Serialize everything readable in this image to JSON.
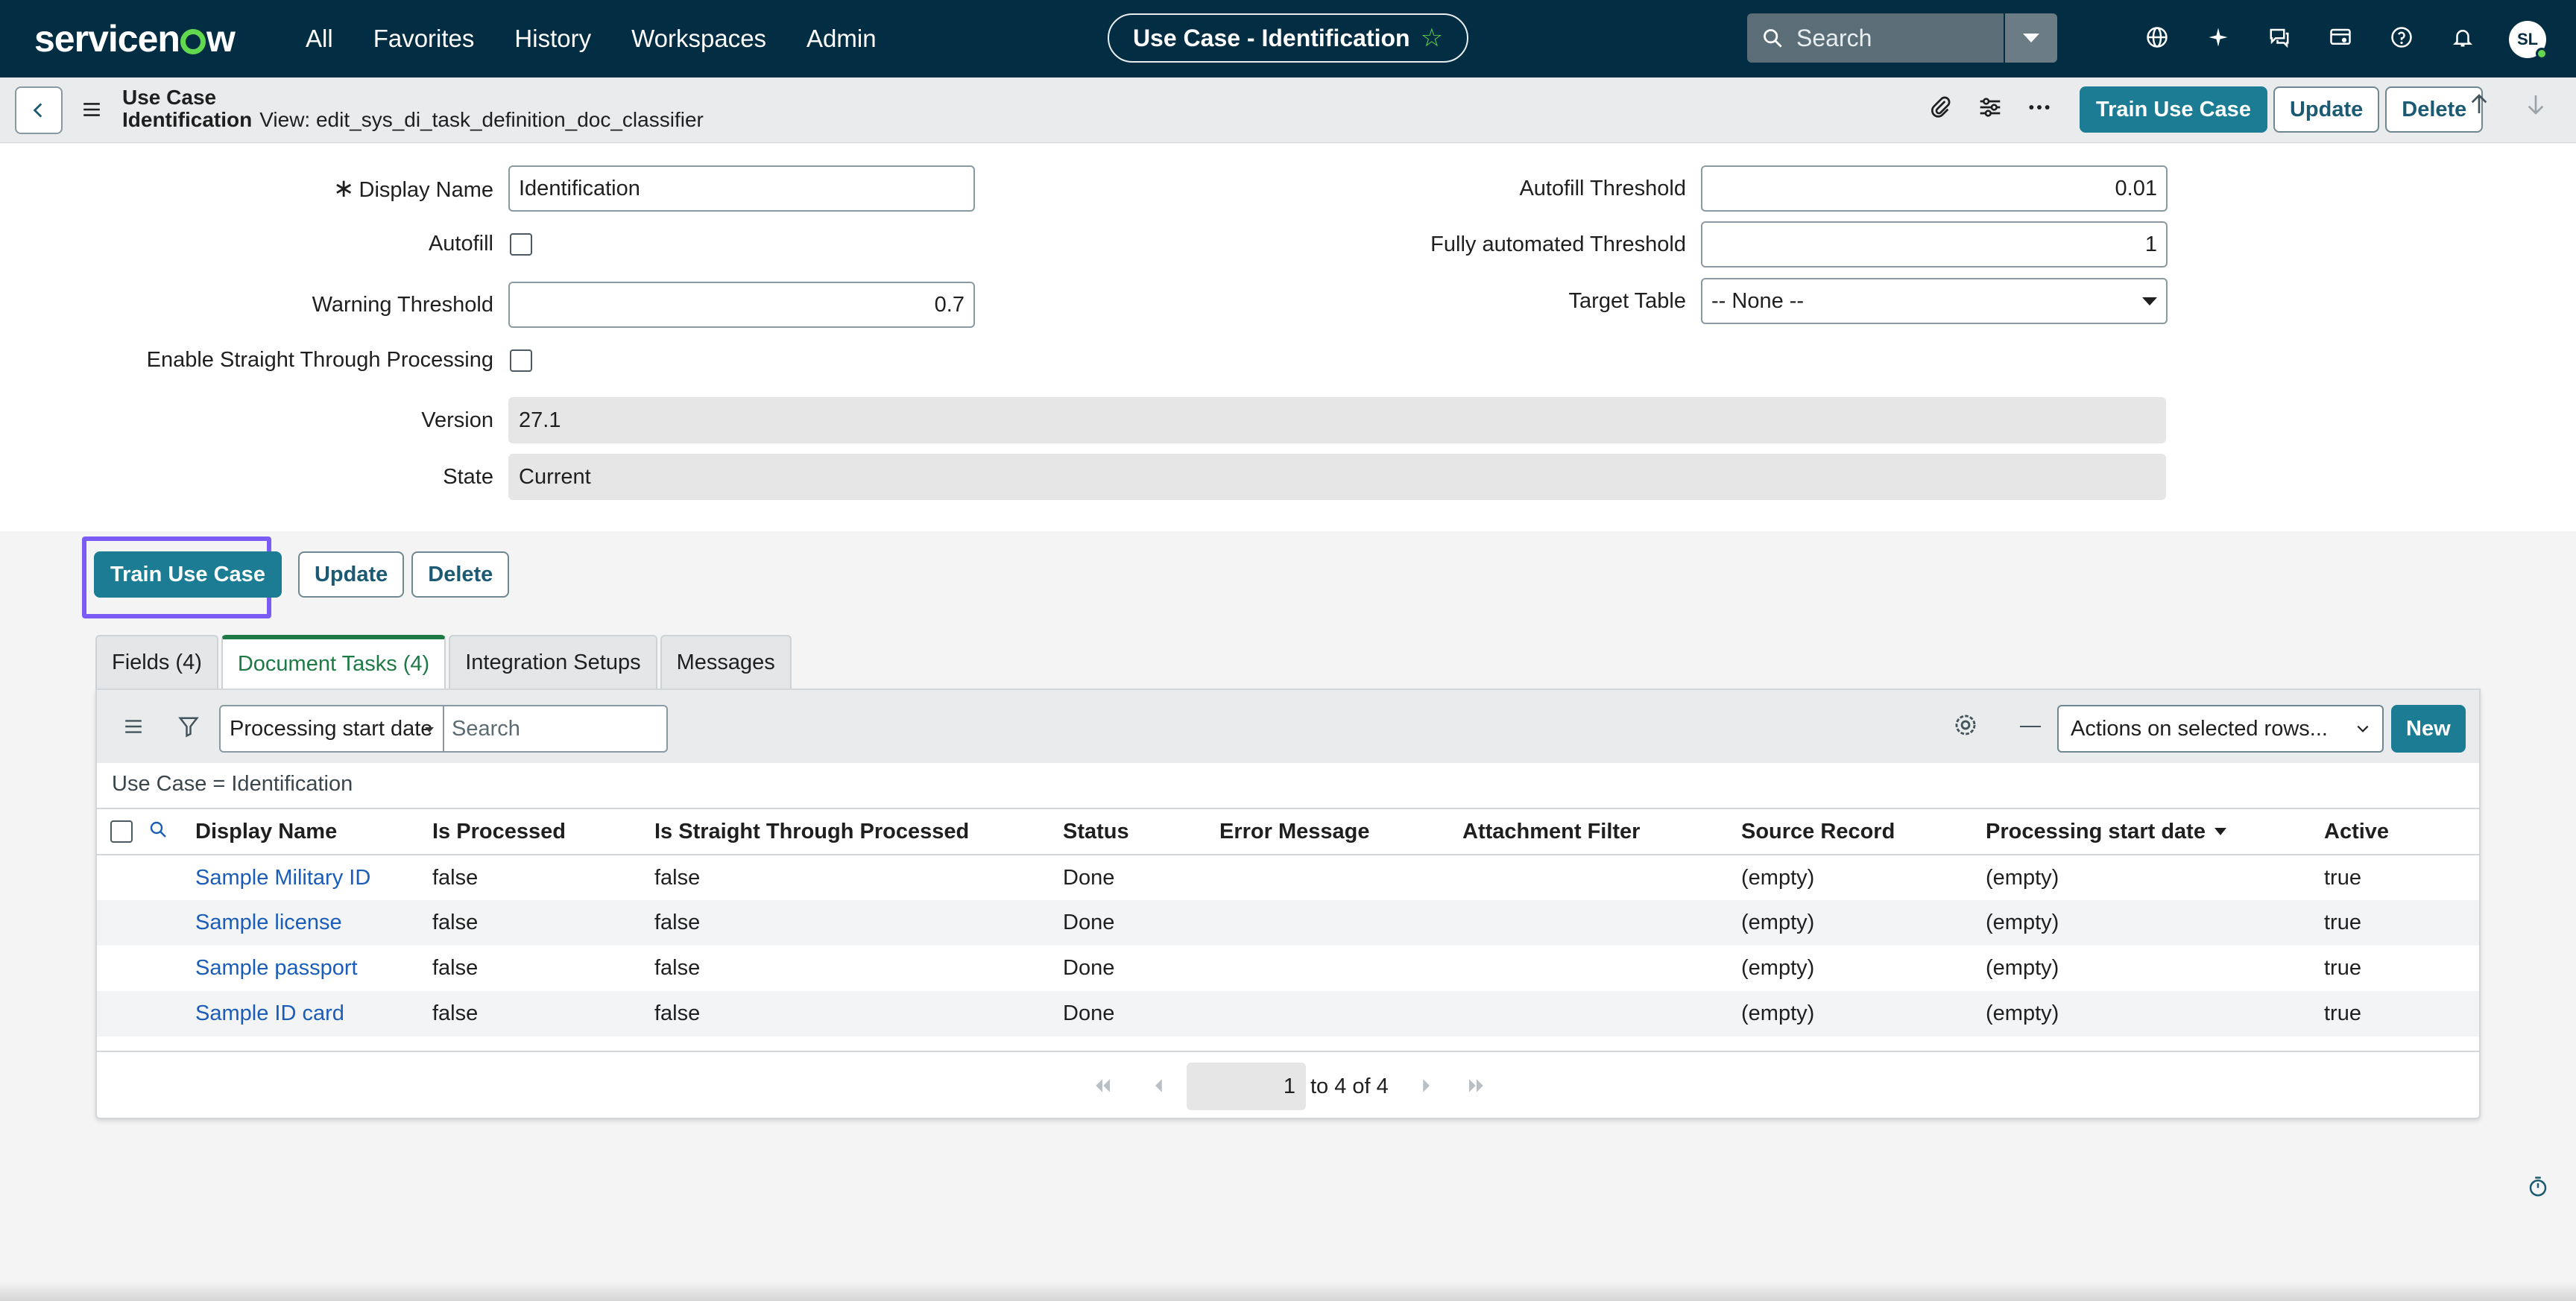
{
  "topnav": {
    "logo": "servicenow",
    "menu": [
      "All",
      "Favorites",
      "History",
      "Workspaces",
      "Admin"
    ],
    "context_title": "Use Case - Identification",
    "search_placeholder": "Search",
    "avatar_initials": "SL",
    "icons": [
      "globe-icon",
      "sparkle-icon",
      "chat-icon",
      "screen-icon",
      "help-icon",
      "bell-icon"
    ]
  },
  "header": {
    "title_line1": "Use Case",
    "title_line2": "Identification",
    "view_text": "View: edit_sys_di_task_definition_doc_classifier",
    "buttons": {
      "train": "Train Use Case",
      "update": "Update",
      "delete": "Delete"
    }
  },
  "form": {
    "display_name": {
      "label": "Display Name",
      "value": "Identification"
    },
    "autofill": {
      "label": "Autofill"
    },
    "warning_threshold": {
      "label": "Warning Threshold",
      "value": "0.7"
    },
    "straight_through": {
      "label": "Enable Straight Through Processing"
    },
    "version": {
      "label": "Version",
      "value": "27.1"
    },
    "state": {
      "label": "State",
      "value": "Current"
    },
    "autofill_threshold": {
      "label": "Autofill Threshold",
      "value": "0.01"
    },
    "fully_automated": {
      "label": "Fully automated Threshold",
      "value": "1"
    },
    "target_table": {
      "label": "Target Table",
      "value": "-- None --"
    }
  },
  "actions": {
    "train": "Train Use Case",
    "update": "Update",
    "delete": "Delete"
  },
  "tabs": [
    "Fields (4)",
    "Document Tasks (4)",
    "Integration Setups",
    "Messages"
  ],
  "list": {
    "field_select": "Processing start date",
    "search_placeholder": "Search",
    "actions_select": "Actions on selected rows...",
    "new_label": "New",
    "breadcrumb": "Use Case = Identification",
    "columns": [
      "Display Name",
      "Is Processed",
      "Is Straight Through Processed",
      "Status",
      "Error Message",
      "Attachment Filter",
      "Source Record",
      "Processing start date",
      "Active"
    ],
    "rows": [
      [
        "Sample Military ID",
        "false",
        "false",
        "Done",
        "",
        "",
        "(empty)",
        "(empty)",
        "true"
      ],
      [
        "Sample license",
        "false",
        "false",
        "Done",
        "",
        "",
        "(empty)",
        "(empty)",
        "true"
      ],
      [
        "Sample passport",
        "false",
        "false",
        "Done",
        "",
        "",
        "(empty)",
        "(empty)",
        "true"
      ],
      [
        "Sample ID card",
        "false",
        "false",
        "Done",
        "",
        "",
        "(empty)",
        "(empty)",
        "true"
      ]
    ],
    "pager": {
      "page": "1",
      "range_text": "to 4 of 4"
    }
  },
  "colors": {
    "nav_bg": "#032d42",
    "primary": "#1b7c94",
    "focus": "#7c5cf6",
    "active_tab": "#1e7a45",
    "link": "#1a5db8"
  }
}
